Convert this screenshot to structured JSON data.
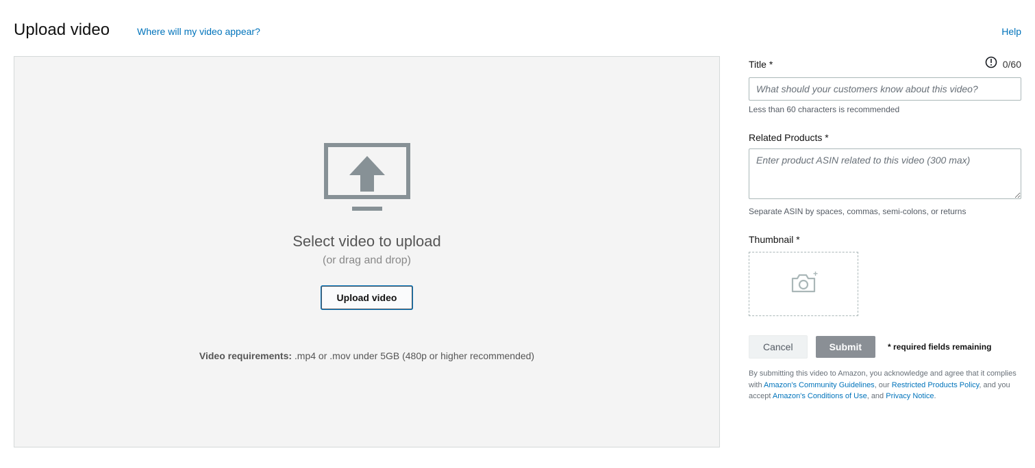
{
  "header": {
    "title": "Upload video",
    "appear_link": "Where will my video appear?",
    "help": "Help"
  },
  "dropzone": {
    "title": "Select video to upload",
    "subtitle": "(or drag and drop)",
    "button": "Upload video",
    "requirements_label": "Video requirements:",
    "requirements_text": " .mp4 or .mov under 5GB (480p or higher recommended)"
  },
  "form": {
    "title": {
      "label": "Title *",
      "counter": "0/60",
      "placeholder": "What should your customers know about this video?",
      "helper": "Less than 60 characters is recommended"
    },
    "related": {
      "label": "Related Products *",
      "placeholder": "Enter product ASIN related to this video (300 max)",
      "helper": "Separate ASIN by spaces, commas, semi-colons, or returns"
    },
    "thumbnail": {
      "label": "Thumbnail *"
    },
    "actions": {
      "cancel": "Cancel",
      "submit": "Submit",
      "req_note": "* required fields remaining"
    },
    "legal": {
      "part1": "By submitting this video to Amazon, you acknowledge and agree that it complies with ",
      "link1": "Amazon's Community Guidelines",
      "part2": ", our ",
      "link2": "Restricted Products Policy",
      "part3": ", and you accept ",
      "link3": "Amazon's Conditions of Use",
      "part4": ", and ",
      "link4": "Privacy Notice",
      "part5": "."
    }
  }
}
